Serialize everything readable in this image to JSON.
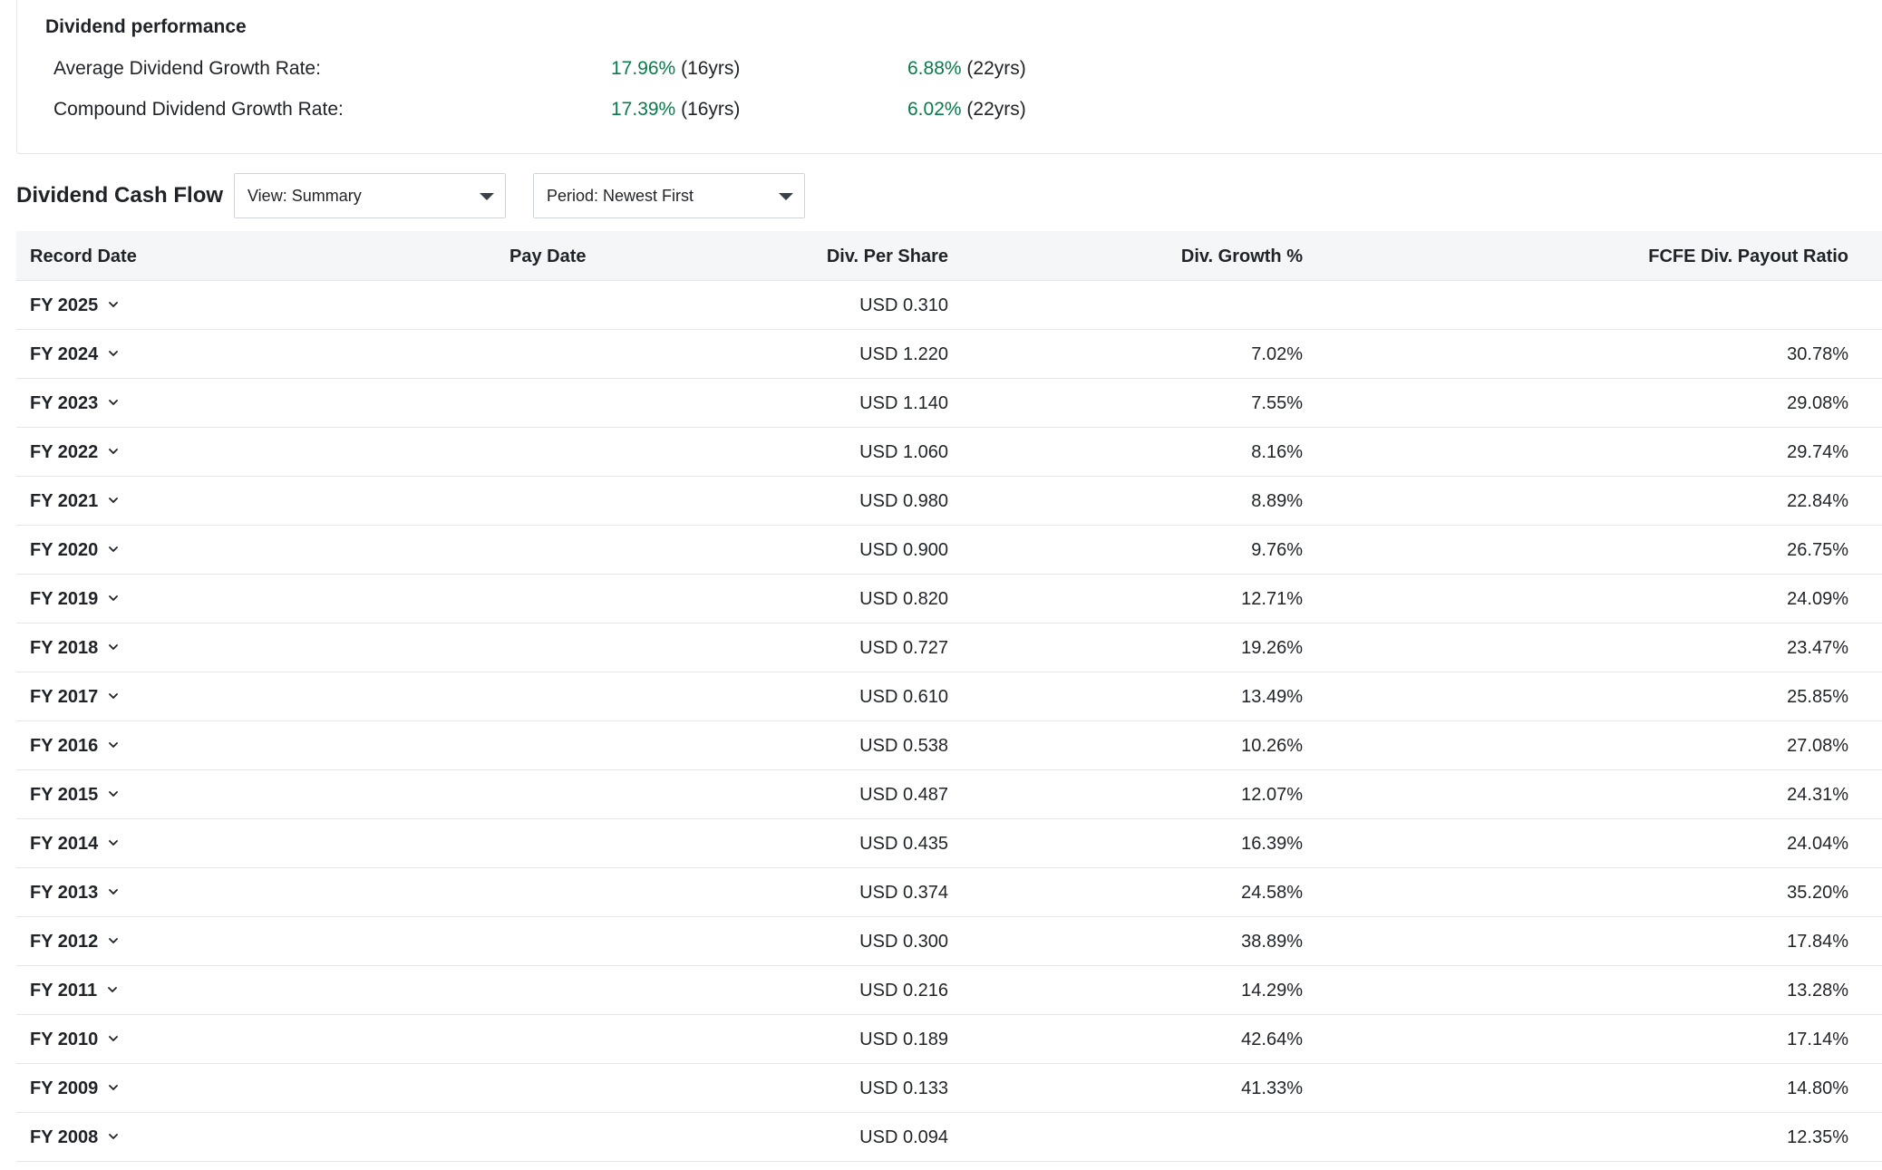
{
  "performance": {
    "title": "Dividend performance",
    "rows": [
      {
        "label": "Average Dividend Growth Rate:",
        "v1_pct": "17.96%",
        "v1_yrs": "(16yrs)",
        "v2_pct": "6.88%",
        "v2_yrs": "(22yrs)"
      },
      {
        "label": "Compound Dividend Growth Rate:",
        "v1_pct": "17.39%",
        "v1_yrs": "(16yrs)",
        "v2_pct": "6.02%",
        "v2_yrs": "(22yrs)"
      }
    ],
    "accent_color": "#0a7a4b"
  },
  "toolbar": {
    "title": "Dividend Cash Flow",
    "view_select": "View: Summary",
    "period_select": "Period: Newest First"
  },
  "table": {
    "headers": {
      "record_date": "Record Date",
      "pay_date": "Pay Date",
      "div_per_share": "Div. Per Share",
      "div_growth": "Div. Growth %",
      "payout_ratio": "FCFE Div. Payout Ratio"
    },
    "rows": [
      {
        "period": "FY 2025",
        "pay_date": "",
        "dps": "USD 0.310",
        "growth": "",
        "payout": ""
      },
      {
        "period": "FY 2024",
        "pay_date": "",
        "dps": "USD 1.220",
        "growth": "7.02%",
        "payout": "30.78%"
      },
      {
        "period": "FY 2023",
        "pay_date": "",
        "dps": "USD 1.140",
        "growth": "7.55%",
        "payout": "29.08%"
      },
      {
        "period": "FY 2022",
        "pay_date": "",
        "dps": "USD 1.060",
        "growth": "8.16%",
        "payout": "29.74%"
      },
      {
        "period": "FY 2021",
        "pay_date": "",
        "dps": "USD 0.980",
        "growth": "8.89%",
        "payout": "22.84%"
      },
      {
        "period": "FY 2020",
        "pay_date": "",
        "dps": "USD 0.900",
        "growth": "9.76%",
        "payout": "26.75%"
      },
      {
        "period": "FY 2019",
        "pay_date": "",
        "dps": "USD 0.820",
        "growth": "12.71%",
        "payout": "24.09%"
      },
      {
        "period": "FY 2018",
        "pay_date": "",
        "dps": "USD 0.727",
        "growth": "19.26%",
        "payout": "23.47%"
      },
      {
        "period": "FY 2017",
        "pay_date": "",
        "dps": "USD 0.610",
        "growth": "13.49%",
        "payout": "25.85%"
      },
      {
        "period": "FY 2016",
        "pay_date": "",
        "dps": "USD 0.538",
        "growth": "10.26%",
        "payout": "27.08%"
      },
      {
        "period": "FY 2015",
        "pay_date": "",
        "dps": "USD 0.487",
        "growth": "12.07%",
        "payout": "24.31%"
      },
      {
        "period": "FY 2014",
        "pay_date": "",
        "dps": "USD 0.435",
        "growth": "16.39%",
        "payout": "24.04%"
      },
      {
        "period": "FY 2013",
        "pay_date": "",
        "dps": "USD 0.374",
        "growth": "24.58%",
        "payout": "35.20%"
      },
      {
        "period": "FY 2012",
        "pay_date": "",
        "dps": "USD 0.300",
        "growth": "38.89%",
        "payout": "17.84%"
      },
      {
        "period": "FY 2011",
        "pay_date": "",
        "dps": "USD 0.216",
        "growth": "14.29%",
        "payout": "13.28%"
      },
      {
        "period": "FY 2010",
        "pay_date": "",
        "dps": "USD 0.189",
        "growth": "42.64%",
        "payout": "17.14%"
      },
      {
        "period": "FY 2009",
        "pay_date": "",
        "dps": "USD 0.133",
        "growth": "41.33%",
        "payout": "14.80%"
      },
      {
        "period": "FY 2008",
        "pay_date": "",
        "dps": "USD 0.094",
        "growth": "",
        "payout": "12.35%"
      }
    ]
  }
}
